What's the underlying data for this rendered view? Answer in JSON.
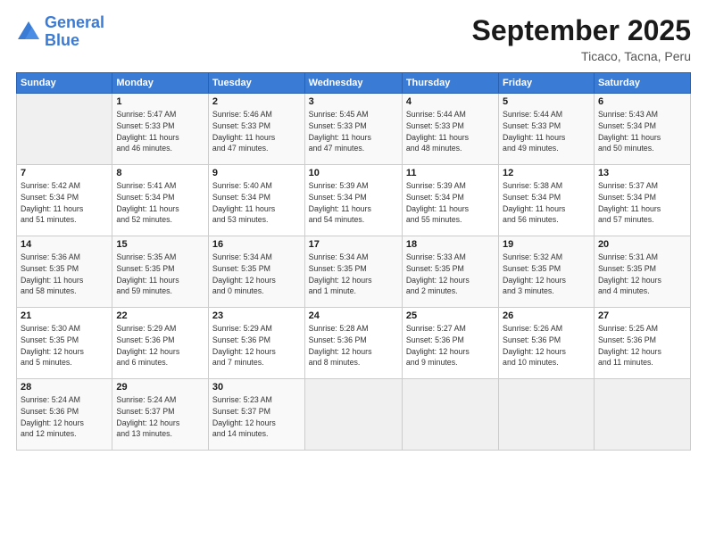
{
  "logo": {
    "text_general": "General",
    "text_blue": "Blue"
  },
  "header": {
    "month_title": "September 2025",
    "location": "Ticaco, Tacna, Peru"
  },
  "weekdays": [
    "Sunday",
    "Monday",
    "Tuesday",
    "Wednesday",
    "Thursday",
    "Friday",
    "Saturday"
  ],
  "weeks": [
    [
      {
        "day": "",
        "info": ""
      },
      {
        "day": "1",
        "info": "Sunrise: 5:47 AM\nSunset: 5:33 PM\nDaylight: 11 hours\nand 46 minutes."
      },
      {
        "day": "2",
        "info": "Sunrise: 5:46 AM\nSunset: 5:33 PM\nDaylight: 11 hours\nand 47 minutes."
      },
      {
        "day": "3",
        "info": "Sunrise: 5:45 AM\nSunset: 5:33 PM\nDaylight: 11 hours\nand 47 minutes."
      },
      {
        "day": "4",
        "info": "Sunrise: 5:44 AM\nSunset: 5:33 PM\nDaylight: 11 hours\nand 48 minutes."
      },
      {
        "day": "5",
        "info": "Sunrise: 5:44 AM\nSunset: 5:33 PM\nDaylight: 11 hours\nand 49 minutes."
      },
      {
        "day": "6",
        "info": "Sunrise: 5:43 AM\nSunset: 5:34 PM\nDaylight: 11 hours\nand 50 minutes."
      }
    ],
    [
      {
        "day": "7",
        "info": "Sunrise: 5:42 AM\nSunset: 5:34 PM\nDaylight: 11 hours\nand 51 minutes."
      },
      {
        "day": "8",
        "info": "Sunrise: 5:41 AM\nSunset: 5:34 PM\nDaylight: 11 hours\nand 52 minutes."
      },
      {
        "day": "9",
        "info": "Sunrise: 5:40 AM\nSunset: 5:34 PM\nDaylight: 11 hours\nand 53 minutes."
      },
      {
        "day": "10",
        "info": "Sunrise: 5:39 AM\nSunset: 5:34 PM\nDaylight: 11 hours\nand 54 minutes."
      },
      {
        "day": "11",
        "info": "Sunrise: 5:39 AM\nSunset: 5:34 PM\nDaylight: 11 hours\nand 55 minutes."
      },
      {
        "day": "12",
        "info": "Sunrise: 5:38 AM\nSunset: 5:34 PM\nDaylight: 11 hours\nand 56 minutes."
      },
      {
        "day": "13",
        "info": "Sunrise: 5:37 AM\nSunset: 5:34 PM\nDaylight: 11 hours\nand 57 minutes."
      }
    ],
    [
      {
        "day": "14",
        "info": "Sunrise: 5:36 AM\nSunset: 5:35 PM\nDaylight: 11 hours\nand 58 minutes."
      },
      {
        "day": "15",
        "info": "Sunrise: 5:35 AM\nSunset: 5:35 PM\nDaylight: 11 hours\nand 59 minutes."
      },
      {
        "day": "16",
        "info": "Sunrise: 5:34 AM\nSunset: 5:35 PM\nDaylight: 12 hours\nand 0 minutes."
      },
      {
        "day": "17",
        "info": "Sunrise: 5:34 AM\nSunset: 5:35 PM\nDaylight: 12 hours\nand 1 minute."
      },
      {
        "day": "18",
        "info": "Sunrise: 5:33 AM\nSunset: 5:35 PM\nDaylight: 12 hours\nand 2 minutes."
      },
      {
        "day": "19",
        "info": "Sunrise: 5:32 AM\nSunset: 5:35 PM\nDaylight: 12 hours\nand 3 minutes."
      },
      {
        "day": "20",
        "info": "Sunrise: 5:31 AM\nSunset: 5:35 PM\nDaylight: 12 hours\nand 4 minutes."
      }
    ],
    [
      {
        "day": "21",
        "info": "Sunrise: 5:30 AM\nSunset: 5:35 PM\nDaylight: 12 hours\nand 5 minutes."
      },
      {
        "day": "22",
        "info": "Sunrise: 5:29 AM\nSunset: 5:36 PM\nDaylight: 12 hours\nand 6 minutes."
      },
      {
        "day": "23",
        "info": "Sunrise: 5:29 AM\nSunset: 5:36 PM\nDaylight: 12 hours\nand 7 minutes."
      },
      {
        "day": "24",
        "info": "Sunrise: 5:28 AM\nSunset: 5:36 PM\nDaylight: 12 hours\nand 8 minutes."
      },
      {
        "day": "25",
        "info": "Sunrise: 5:27 AM\nSunset: 5:36 PM\nDaylight: 12 hours\nand 9 minutes."
      },
      {
        "day": "26",
        "info": "Sunrise: 5:26 AM\nSunset: 5:36 PM\nDaylight: 12 hours\nand 10 minutes."
      },
      {
        "day": "27",
        "info": "Sunrise: 5:25 AM\nSunset: 5:36 PM\nDaylight: 12 hours\nand 11 minutes."
      }
    ],
    [
      {
        "day": "28",
        "info": "Sunrise: 5:24 AM\nSunset: 5:36 PM\nDaylight: 12 hours\nand 12 minutes."
      },
      {
        "day": "29",
        "info": "Sunrise: 5:24 AM\nSunset: 5:37 PM\nDaylight: 12 hours\nand 13 minutes."
      },
      {
        "day": "30",
        "info": "Sunrise: 5:23 AM\nSunset: 5:37 PM\nDaylight: 12 hours\nand 14 minutes."
      },
      {
        "day": "",
        "info": ""
      },
      {
        "day": "",
        "info": ""
      },
      {
        "day": "",
        "info": ""
      },
      {
        "day": "",
        "info": ""
      }
    ]
  ]
}
